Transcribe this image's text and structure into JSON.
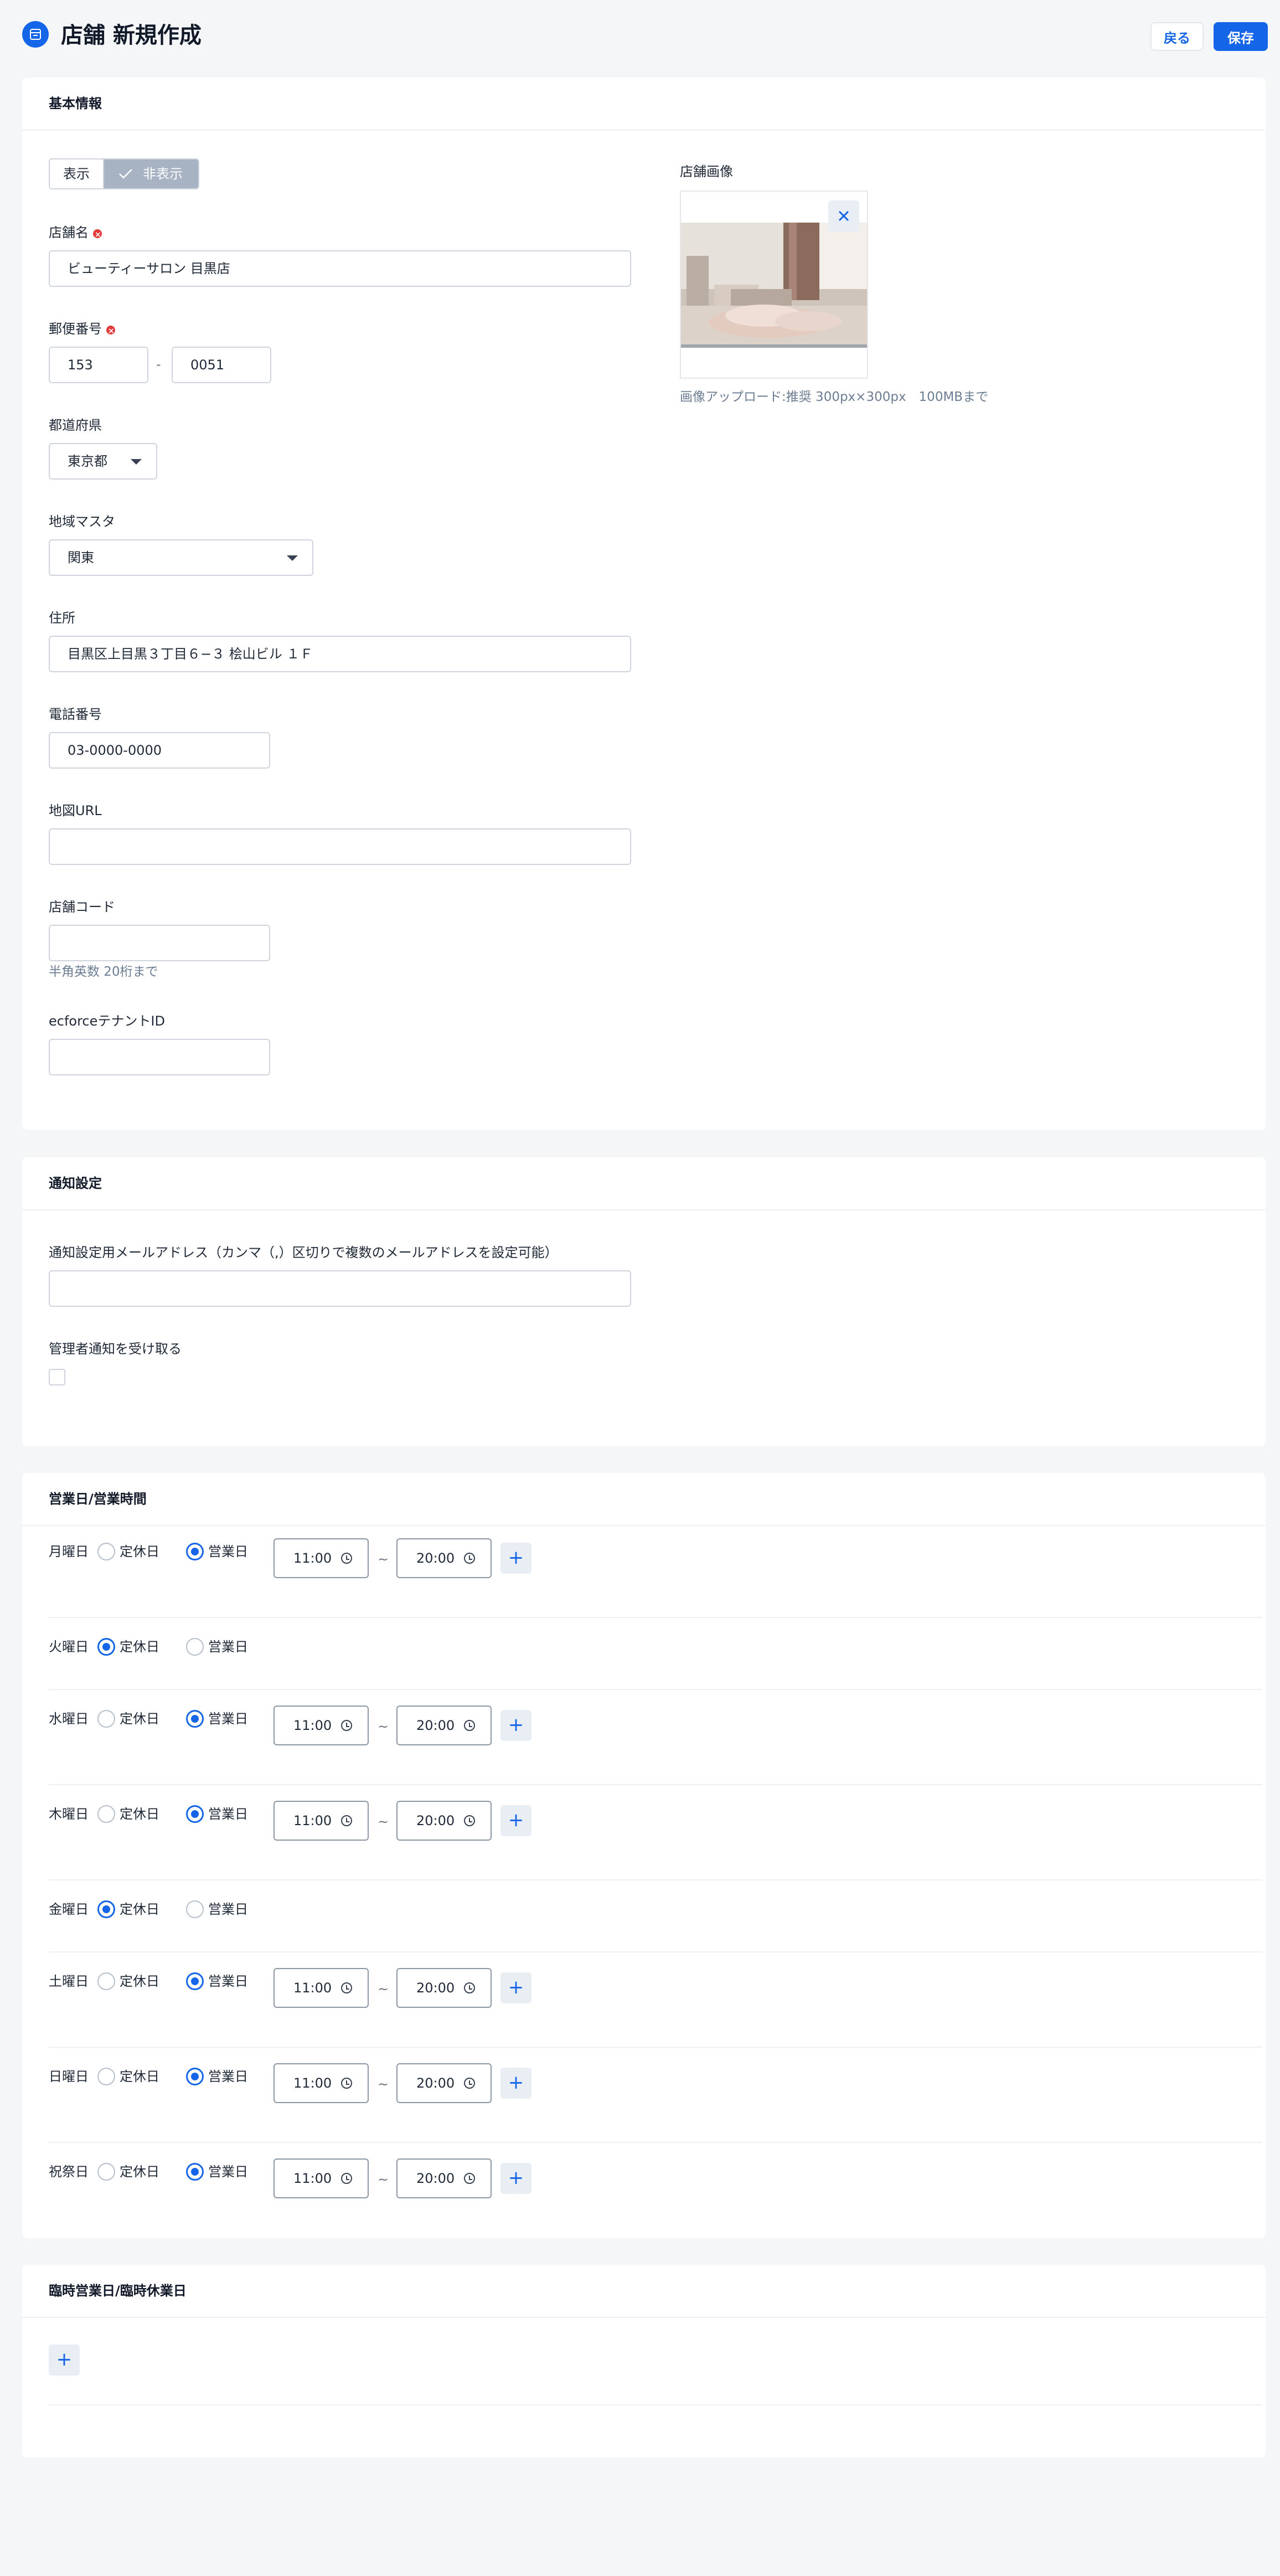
{
  "header": {
    "title": "店舗 新規作成",
    "back_label": "戻る",
    "save_label": "保存"
  },
  "basic": {
    "section_title": "基本情報",
    "visibility": {
      "options": [
        "表示",
        "非表示"
      ],
      "selected": "非表示"
    },
    "store_name": {
      "label": "店舗名",
      "value": "ビューティーサロン 目黒店"
    },
    "postal": {
      "label": "郵便番号",
      "part1": "153",
      "separator": "-",
      "part2": "0051"
    },
    "prefecture": {
      "label": "都道府県",
      "value": "東京都"
    },
    "region": {
      "label": "地域マスタ",
      "value": "関東"
    },
    "address": {
      "label": "住所",
      "value": "目黒区上目黒３丁目６−３ 桧山ビル １Ｆ"
    },
    "phone": {
      "label": "電話番号",
      "value": "03-0000-0000"
    },
    "map_url": {
      "label": "地図URL",
      "value": ""
    },
    "store_code": {
      "label": "店舗コード",
      "value": "",
      "hint": "半角英数 20桁まで"
    },
    "tenant_id": {
      "label": "ecforceテナントID",
      "value": ""
    },
    "image": {
      "label": "店舗画像",
      "hint": "画像アップロード:推奨 300px×300px　100MBまで"
    }
  },
  "notification": {
    "section_title": "通知設定",
    "email": {
      "label": "通知設定用メールアドレス（カンマ（,）区切りで複数のメールアドレスを設定可能）",
      "value": ""
    },
    "admin": {
      "label": "管理者通知を受け取る",
      "checked": false
    }
  },
  "hours": {
    "section_title": "営業日/営業時間",
    "closed_label": "定休日",
    "open_label": "営業日",
    "tilde": "~",
    "days": [
      {
        "name": "月曜日",
        "status": "open",
        "start": "11:00",
        "end": "20:00"
      },
      {
        "name": "火曜日",
        "status": "closed"
      },
      {
        "name": "水曜日",
        "status": "open",
        "start": "11:00",
        "end": "20:00"
      },
      {
        "name": "木曜日",
        "status": "open",
        "start": "11:00",
        "end": "20:00"
      },
      {
        "name": "金曜日",
        "status": "closed"
      },
      {
        "name": "土曜日",
        "status": "open",
        "start": "11:00",
        "end": "20:00"
      },
      {
        "name": "日曜日",
        "status": "open",
        "start": "11:00",
        "end": "20:00"
      },
      {
        "name": "祝祭日",
        "status": "open",
        "start": "11:00",
        "end": "20:00"
      }
    ]
  },
  "special": {
    "section_title": "臨時営業日/臨時休業日"
  },
  "icons": {
    "plus": "+",
    "close": "close-icon",
    "clock": "clock-icon",
    "check": "check-icon",
    "store": "store-icon"
  },
  "colors": {
    "accent": "#1565e8",
    "required": "#e23b3b"
  }
}
